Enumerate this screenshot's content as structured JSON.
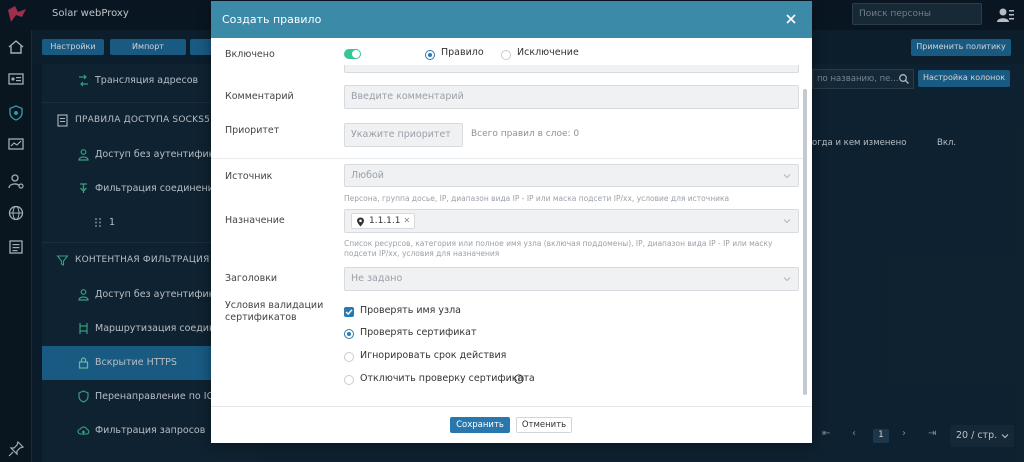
{
  "app": {
    "title": "Solar webProxy",
    "search_placeholder": "Поиск персоны"
  },
  "subbar": {
    "settings": "Настройки",
    "import": "Импорт"
  },
  "tree": {
    "items": [
      {
        "label": "Трансляция адресов",
        "icon": "translate-icon"
      },
      {
        "label": "ПРАВИЛА ДОСТУПА SOCKS5",
        "icon": "doc-icon"
      },
      {
        "label": "Доступ без аутентификации",
        "icon": "key-icon"
      },
      {
        "label": "Фильтрация соединений",
        "icon": "filter-icon"
      },
      {
        "label": "1",
        "icon": "drag-handle-icon"
      },
      {
        "label": "КОНТЕНТНАЯ ФИЛЬТРАЦИЯ",
        "icon": "funnel-icon"
      },
      {
        "label": "Доступ без аутентификации",
        "icon": "key-icon"
      },
      {
        "label": "Маршрутизация соединений",
        "icon": "route-icon"
      },
      {
        "label": "Вскрытие HTTPS",
        "icon": "lock-icon"
      },
      {
        "label": "Перенаправление по ICAP",
        "icon": "shield-icon"
      },
      {
        "label": "Фильтрация запросов",
        "icon": "cloud-upload-icon"
      }
    ]
  },
  "right": {
    "apply_policy": "Применить политику",
    "search_placeholder": "по названию, пе...",
    "columns_settings": "Настройка колонок",
    "col_changed": "огда и кем изменено",
    "col_enabled": "Вкл.",
    "page_current": "1",
    "page_size": "20 / стр."
  },
  "modal": {
    "title": "Создать правило",
    "enabled_label": "Включено",
    "rule_type": {
      "rule": "Правило",
      "exception": "Исключение",
      "selected": "Правило"
    },
    "comment_label": "Комментарий",
    "comment_placeholder": "Введите комментарий",
    "priority_label": "Приоритет",
    "priority_placeholder": "Укажите приоритет",
    "priority_note": "Всего правил в слое: 0",
    "source_label": "Источник",
    "source_value": "Любой",
    "source_hint": "Персона, группа досье, IP, диапазон вида IP - IP или маска подсети IP/xx, условие для источника",
    "dest_label": "Назначение",
    "dest_tags": [
      "1.1.1.1"
    ],
    "dest_hint": "Список ресурсов, категория или полное имя узла (включая поддомены), IP, диапазон вида IP - IP или маску подсети IP/xx, условия для назначения",
    "headers_label": "Заголовки",
    "headers_value": "Не задано",
    "cert_label": "Условия валидации сертификатов",
    "check_host": "Проверять имя узла",
    "cert_options": [
      "Проверять сертификат",
      "Игнорировать срок действия",
      "Отключить проверку сертификата"
    ],
    "cert_selected": "Проверять сертификат",
    "save": "Сохранить",
    "cancel": "Отменить"
  }
}
